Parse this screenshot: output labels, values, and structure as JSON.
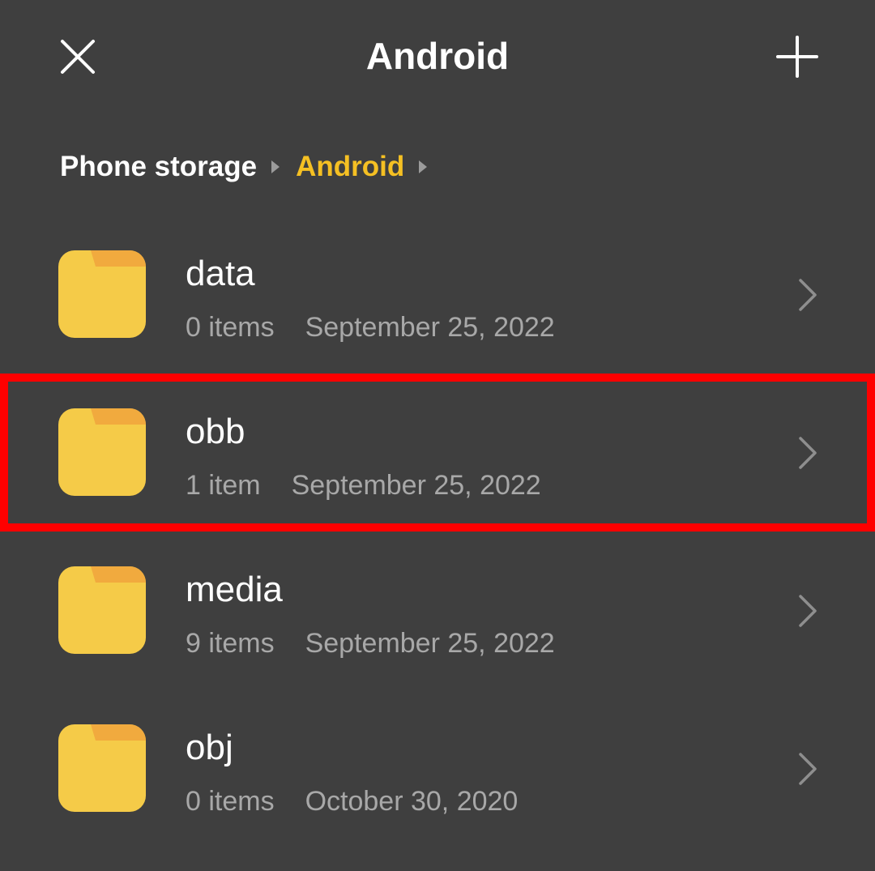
{
  "header": {
    "title": "Android",
    "close_icon": "close-icon",
    "add_icon": "plus-icon"
  },
  "breadcrumb": {
    "items": [
      "Phone storage",
      "Android"
    ]
  },
  "colors": {
    "background": "#3f3f3f",
    "accent": "#f5c023",
    "folder": "#f5cb48",
    "folder_tab": "#f1aa3e",
    "highlight": "#ff0000"
  },
  "folders": [
    {
      "name": "data",
      "count": "0 items",
      "date": "September 25, 2022"
    },
    {
      "name": "obb",
      "count": "1 item",
      "date": "September 25, 2022",
      "highlighted": true
    },
    {
      "name": "media",
      "count": "9 items",
      "date": "September 25, 2022"
    },
    {
      "name": "obj",
      "count": "0 items",
      "date": "October 30, 2020"
    }
  ]
}
